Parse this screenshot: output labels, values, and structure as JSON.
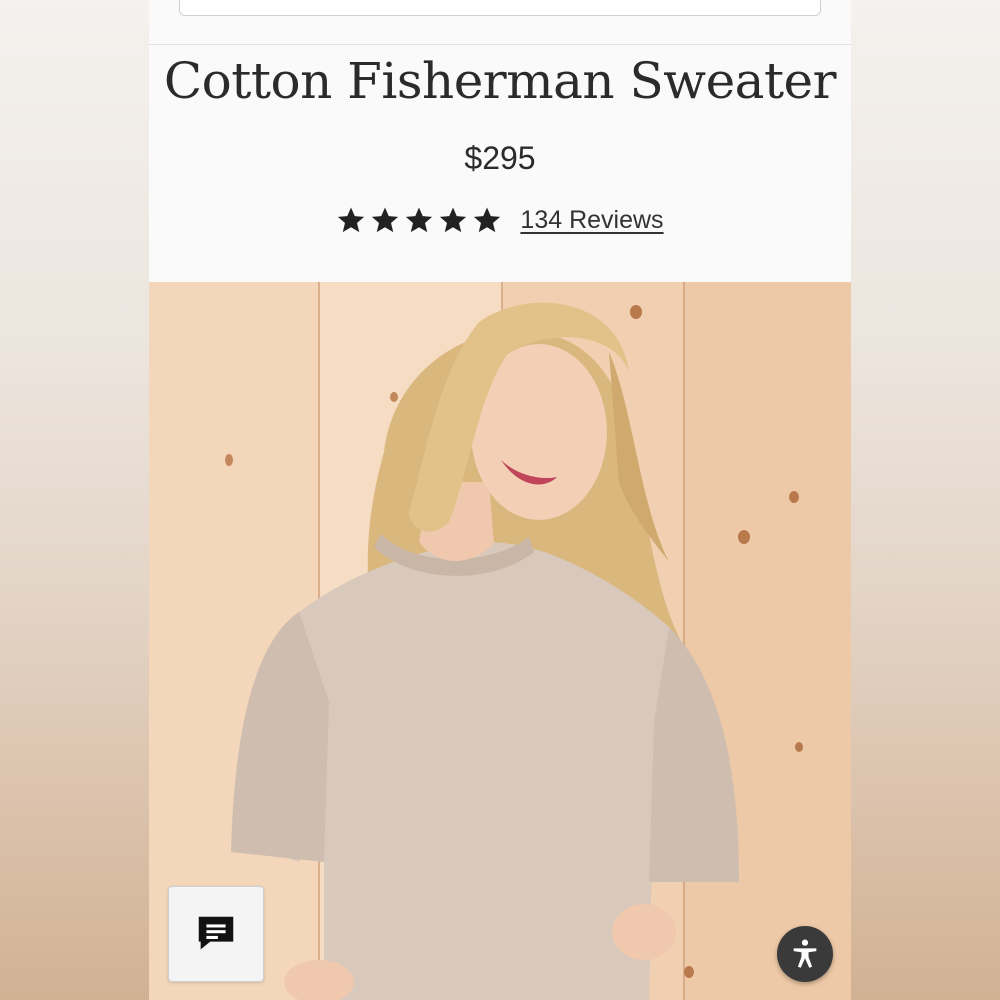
{
  "product": {
    "title": "Cotton Fisherman Sweater",
    "price": "$295",
    "rating": 5,
    "reviews_label": "134 Reviews"
  },
  "icons": {
    "star": "star-icon",
    "chat": "chat-icon",
    "accessibility": "accessibility-icon"
  },
  "colors": {
    "text": "#2b2b2b",
    "star": "#222222",
    "accessibility_bg": "#3a3a3a"
  }
}
